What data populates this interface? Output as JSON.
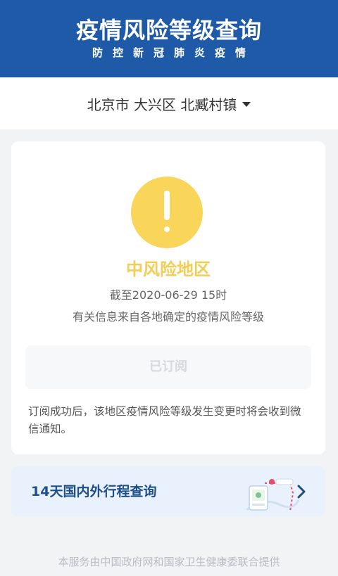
{
  "header": {
    "title": "疫情风险等级查询",
    "subtitle": "防控新冠肺炎疫情"
  },
  "location": {
    "selected": "北京市 大兴区 北臧村镇",
    "dropdown_icon": "caret-down-icon"
  },
  "risk": {
    "icon": "exclamation-circle-icon",
    "level": "中风险地区",
    "as_of": "截至2020-06-29 15时",
    "source": "有关信息来自各地确定的疫情风险等级",
    "color": "#f9d65a"
  },
  "subscribe": {
    "button_label": "已订阅",
    "note": "订阅成功后，该地区疫情风险等级发生变更时将会收到微信通知。"
  },
  "itinerary": {
    "label": "14天国内外行程查询",
    "arrow_icon": "chevron-right-icon"
  },
  "footer": {
    "text": "本服务由中国政府网和国家卫生健康委联合提供"
  },
  "colors": {
    "header_bg": "#1e5aa8",
    "accent": "#1e4f8a",
    "risk_yellow": "#f3cd55"
  }
}
